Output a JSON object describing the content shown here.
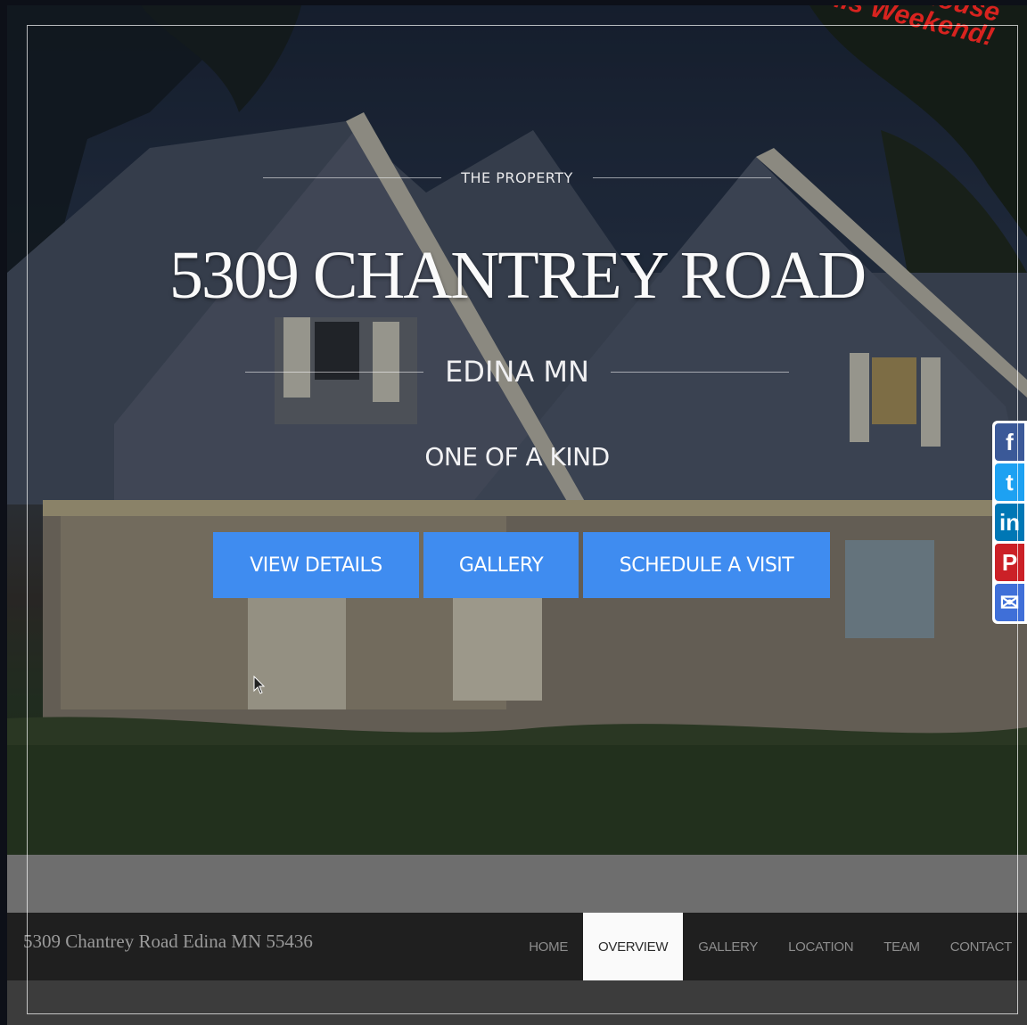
{
  "promo_stamp": [
    "...ouse",
    "This Weekend!"
  ],
  "hero": {
    "kicker": "THE PROPERTY",
    "title": "5309 CHANTREY ROAD",
    "city": "EDINA MN",
    "tagline": "ONE OF A KIND",
    "buttons": [
      "VIEW DETAILS",
      "GALLERY",
      "SCHEDULE A VISIT"
    ],
    "button_color": "#3f8cf0"
  },
  "social": {
    "icons": [
      "facebook-icon",
      "twitter-icon",
      "linkedin-icon",
      "pinterest-icon",
      "email-icon"
    ],
    "glyphs": [
      "f",
      "t",
      "in",
      "P",
      "✉"
    ],
    "colors": [
      "#3b5998",
      "#1da1f2",
      "#0077b5",
      "#cb2027",
      "#3f6fd8"
    ]
  },
  "footer_bar": {
    "address": "5309 Chantrey Road Edina MN 55436",
    "nav": [
      "HOME",
      "OVERVIEW",
      "GALLERY",
      "LOCATION",
      "TEAM",
      "CONTACT"
    ],
    "active": "OVERVIEW"
  }
}
